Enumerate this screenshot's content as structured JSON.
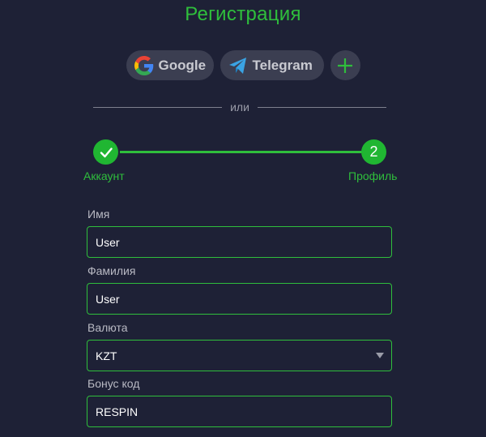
{
  "title": "Регистрация",
  "social": {
    "google_label": "Google",
    "telegram_label": "Telegram",
    "more_icon": "plus-icon"
  },
  "divider_text": "или",
  "stepper": {
    "steps": [
      {
        "label": "Аккаунт",
        "status": "completed",
        "icon": "check-icon"
      },
      {
        "label": "Профиль",
        "number": "2",
        "status": "active"
      }
    ]
  },
  "form": {
    "first_name": {
      "label": "Имя",
      "value": "User"
    },
    "last_name": {
      "label": "Фамилия",
      "value": "User"
    },
    "currency": {
      "label": "Валюта",
      "value": "KZT"
    },
    "bonus_code": {
      "label": "Бонус код",
      "value": "RESPIN"
    }
  },
  "colors": {
    "background": "#1e2136",
    "accent": "#2fbe3c",
    "button_bg": "#3b3e51"
  }
}
